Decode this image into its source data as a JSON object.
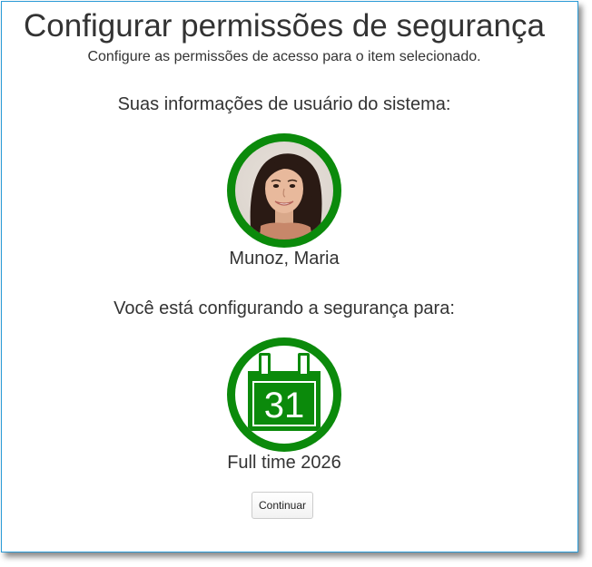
{
  "header": {
    "title": "Configurar permissões de segurança",
    "subtitle": "Configure as permissões de acesso para o item selecionado."
  },
  "user_section": {
    "label": "Suas informações de usuário do sistema:",
    "user_name": "Munoz, Maria"
  },
  "target_section": {
    "label": "Você está configurando a segurança para:",
    "calendar_day": "31",
    "item_name": "Full time 2026"
  },
  "actions": {
    "continue_label": "Continuar"
  },
  "colors": {
    "accent_green": "#0b8a0b",
    "frame_border": "#2a9ad6"
  },
  "icons": {
    "avatar": "user-photo",
    "calendar": "calendar-icon"
  }
}
